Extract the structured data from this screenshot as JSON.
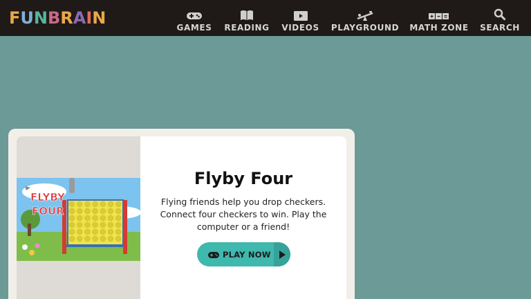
{
  "header": {
    "logo_letters": [
      {
        "ch": "F",
        "color": "#e8a94a"
      },
      {
        "ch": "U",
        "color": "#7fb0d8"
      },
      {
        "ch": "N",
        "color": "#58b59c"
      },
      {
        "ch": "B",
        "color": "#c86a86"
      },
      {
        "ch": "R",
        "color": "#e8a94a"
      },
      {
        "ch": "A",
        "color": "#8c6bb1"
      },
      {
        "ch": "I",
        "color": "#e26d5a"
      },
      {
        "ch": "N",
        "color": "#e8a94a"
      }
    ],
    "nav": [
      {
        "label": "GAMES",
        "icon": "gamepad-icon"
      },
      {
        "label": "READING",
        "icon": "book-icon"
      },
      {
        "label": "VIDEOS",
        "icon": "video-icon"
      },
      {
        "label": "PLAYGROUND",
        "icon": "seesaw-icon"
      },
      {
        "label": "MATH ZONE",
        "icon": "math-symbols-icon"
      },
      {
        "label": "SEARCH",
        "icon": "magnifier-icon"
      }
    ]
  },
  "card": {
    "image_text": {
      "line1": "FLYBY",
      "line2": "FOUR"
    },
    "title": "Flyby Four",
    "description": "Flying friends help you drop checkers. Connect four checkers to win. Play the computer or a friend!",
    "play_label": "PLAY NOW"
  },
  "colors": {
    "background": "#6b9a97",
    "header": "#1f1a17",
    "button": "#3fb8ae"
  }
}
